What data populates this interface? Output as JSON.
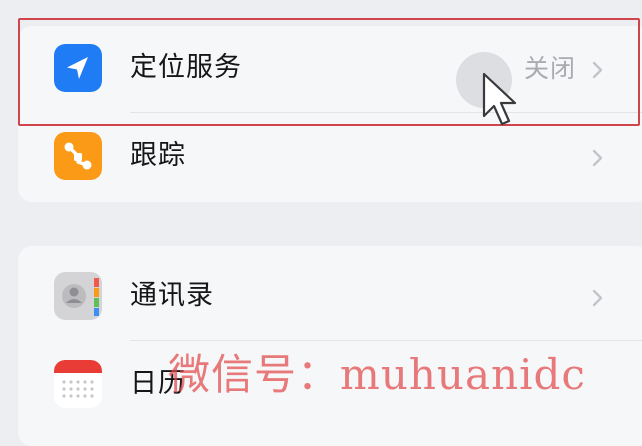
{
  "colors": {
    "background": "#eceef2",
    "group_background": "#f6f7f9",
    "location_icon": "#1f7cf5",
    "tracking_icon": "#fb9a16",
    "highlight_border": "#d0444b",
    "value_text": "#a9abb0",
    "watermark": "#e24848"
  },
  "settings": {
    "group1": [
      {
        "icon": "location-arrow-icon",
        "label": "定位服务",
        "value": "关闭"
      },
      {
        "icon": "tracking-icon",
        "label": "跟踪"
      }
    ],
    "group2": [
      {
        "icon": "contacts-icon",
        "label": "通讯录"
      },
      {
        "icon": "calendar-icon",
        "label": "日历"
      }
    ]
  },
  "watermark": "微信号：muhuanidc"
}
